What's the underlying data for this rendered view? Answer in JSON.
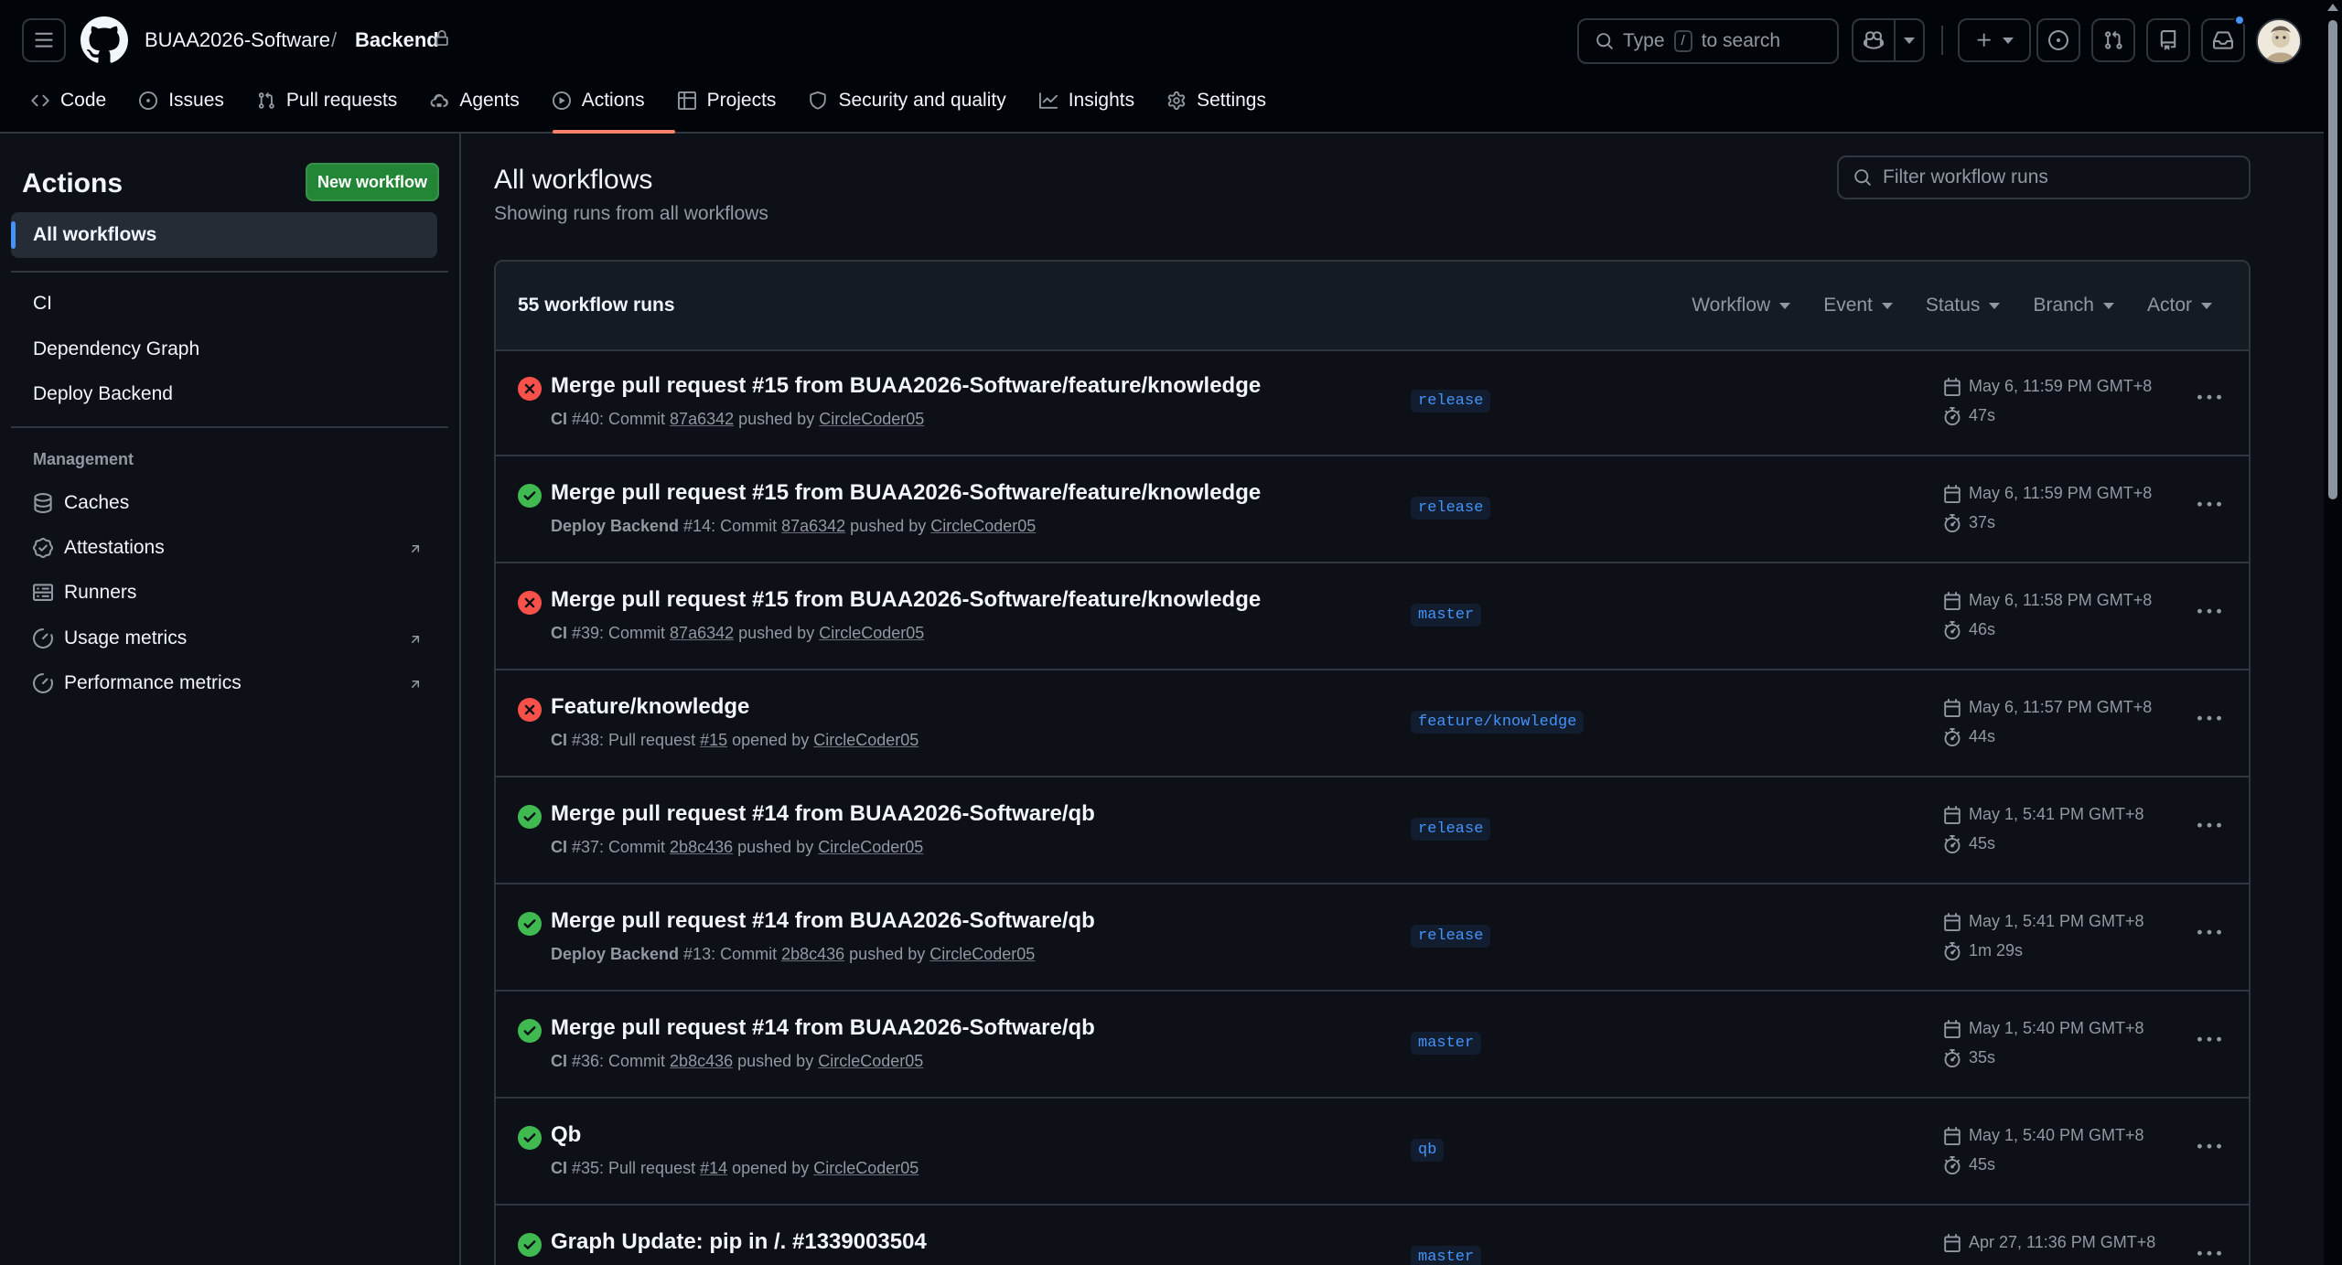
{
  "header": {
    "org": "BUAA2026-Software",
    "separator": "/",
    "repo": "Backend",
    "search_placeholder": "Type",
    "search_key": "/",
    "search_suffix": "to search"
  },
  "repo_nav": [
    {
      "label": "Code",
      "icon": "code-icon"
    },
    {
      "label": "Issues",
      "icon": "issue-icon"
    },
    {
      "label": "Pull requests",
      "icon": "pull-request-icon"
    },
    {
      "label": "Agents",
      "icon": "agents-icon"
    },
    {
      "label": "Actions",
      "icon": "play-icon"
    },
    {
      "label": "Projects",
      "icon": "table-icon"
    },
    {
      "label": "Security and quality",
      "icon": "shield-icon"
    },
    {
      "label": "Insights",
      "icon": "graph-icon"
    },
    {
      "label": "Settings",
      "icon": "gear-icon"
    }
  ],
  "sidebar": {
    "title": "Actions",
    "new_workflow": "New workflow",
    "all_workflows": "All workflows",
    "workflows": [
      "CI",
      "Dependency Graph",
      "Deploy Backend"
    ],
    "management_label": "Management",
    "management": [
      "Caches",
      "Attestations",
      "Runners",
      "Usage metrics",
      "Performance metrics"
    ]
  },
  "main": {
    "title": "All workflows",
    "subtitle": "Showing runs from all workflows",
    "filter_placeholder": "Filter workflow runs",
    "runs_count": "55 workflow runs",
    "filters": [
      "Workflow",
      "Event",
      "Status",
      "Branch",
      "Actor"
    ]
  },
  "runs": [
    {
      "status": "failure",
      "title": "Merge pull request #15 from BUAA2026-Software/feature/knowledge",
      "workflow": "CI",
      "meta_num": " #40: Commit ",
      "ref": "87a6342",
      "verb": " pushed by ",
      "actor": "CircleCoder05",
      "branch": "release",
      "date": "May 6, 11:59 PM GMT+8",
      "duration": "47s"
    },
    {
      "status": "success",
      "title": "Merge pull request #15 from BUAA2026-Software/feature/knowledge",
      "workflow": "Deploy Backend",
      "meta_num": " #14: Commit ",
      "ref": "87a6342",
      "verb": " pushed by ",
      "actor": "CircleCoder05",
      "branch": "release",
      "date": "May 6, 11:59 PM GMT+8",
      "duration": "37s"
    },
    {
      "status": "failure",
      "title": "Merge pull request #15 from BUAA2026-Software/feature/knowledge",
      "workflow": "CI",
      "meta_num": " #39: Commit ",
      "ref": "87a6342",
      "verb": " pushed by ",
      "actor": "CircleCoder05",
      "branch": "master",
      "date": "May 6, 11:58 PM GMT+8",
      "duration": "46s"
    },
    {
      "status": "failure",
      "title": "Feature/knowledge",
      "workflow": "CI",
      "meta_num": " #38: Pull request ",
      "ref": "#15",
      "verb": " opened by ",
      "actor": "CircleCoder05",
      "branch": "feature/knowledge",
      "date": "May 6, 11:57 PM GMT+8",
      "duration": "44s"
    },
    {
      "status": "success",
      "title": "Merge pull request #14 from BUAA2026-Software/qb",
      "workflow": "CI",
      "meta_num": " #37: Commit ",
      "ref": "2b8c436",
      "verb": " pushed by ",
      "actor": "CircleCoder05",
      "branch": "release",
      "date": "May 1, 5:41 PM GMT+8",
      "duration": "45s"
    },
    {
      "status": "success",
      "title": "Merge pull request #14 from BUAA2026-Software/qb",
      "workflow": "Deploy Backend",
      "meta_num": " #13: Commit ",
      "ref": "2b8c436",
      "verb": " pushed by ",
      "actor": "CircleCoder05",
      "branch": "release",
      "date": "May 1, 5:41 PM GMT+8",
      "duration": "1m 29s"
    },
    {
      "status": "success",
      "title": "Merge pull request #14 from BUAA2026-Software/qb",
      "workflow": "CI",
      "meta_num": " #36: Commit ",
      "ref": "2b8c436",
      "verb": " pushed by ",
      "actor": "CircleCoder05",
      "branch": "master",
      "date": "May 1, 5:40 PM GMT+8",
      "duration": "35s"
    },
    {
      "status": "success",
      "title": "Qb",
      "workflow": "CI",
      "meta_num": " #35: Pull request ",
      "ref": "#14",
      "verb": " opened by ",
      "actor": "CircleCoder05",
      "branch": "qb",
      "date": "May 1, 5:40 PM GMT+8",
      "duration": "45s"
    },
    {
      "status": "success",
      "title": "Graph Update: pip in /. #1339003504",
      "workflow": "",
      "meta_num": "",
      "ref": "",
      "verb": "",
      "actor": "",
      "branch": "master",
      "date": "Apr 27, 11:36 PM GMT+8",
      "duration": ""
    }
  ],
  "colors": {
    "success": "#3fb950",
    "failure": "#f85149",
    "accent": "#4493f8",
    "underline": "#f78166",
    "primary_button": "#238636"
  }
}
